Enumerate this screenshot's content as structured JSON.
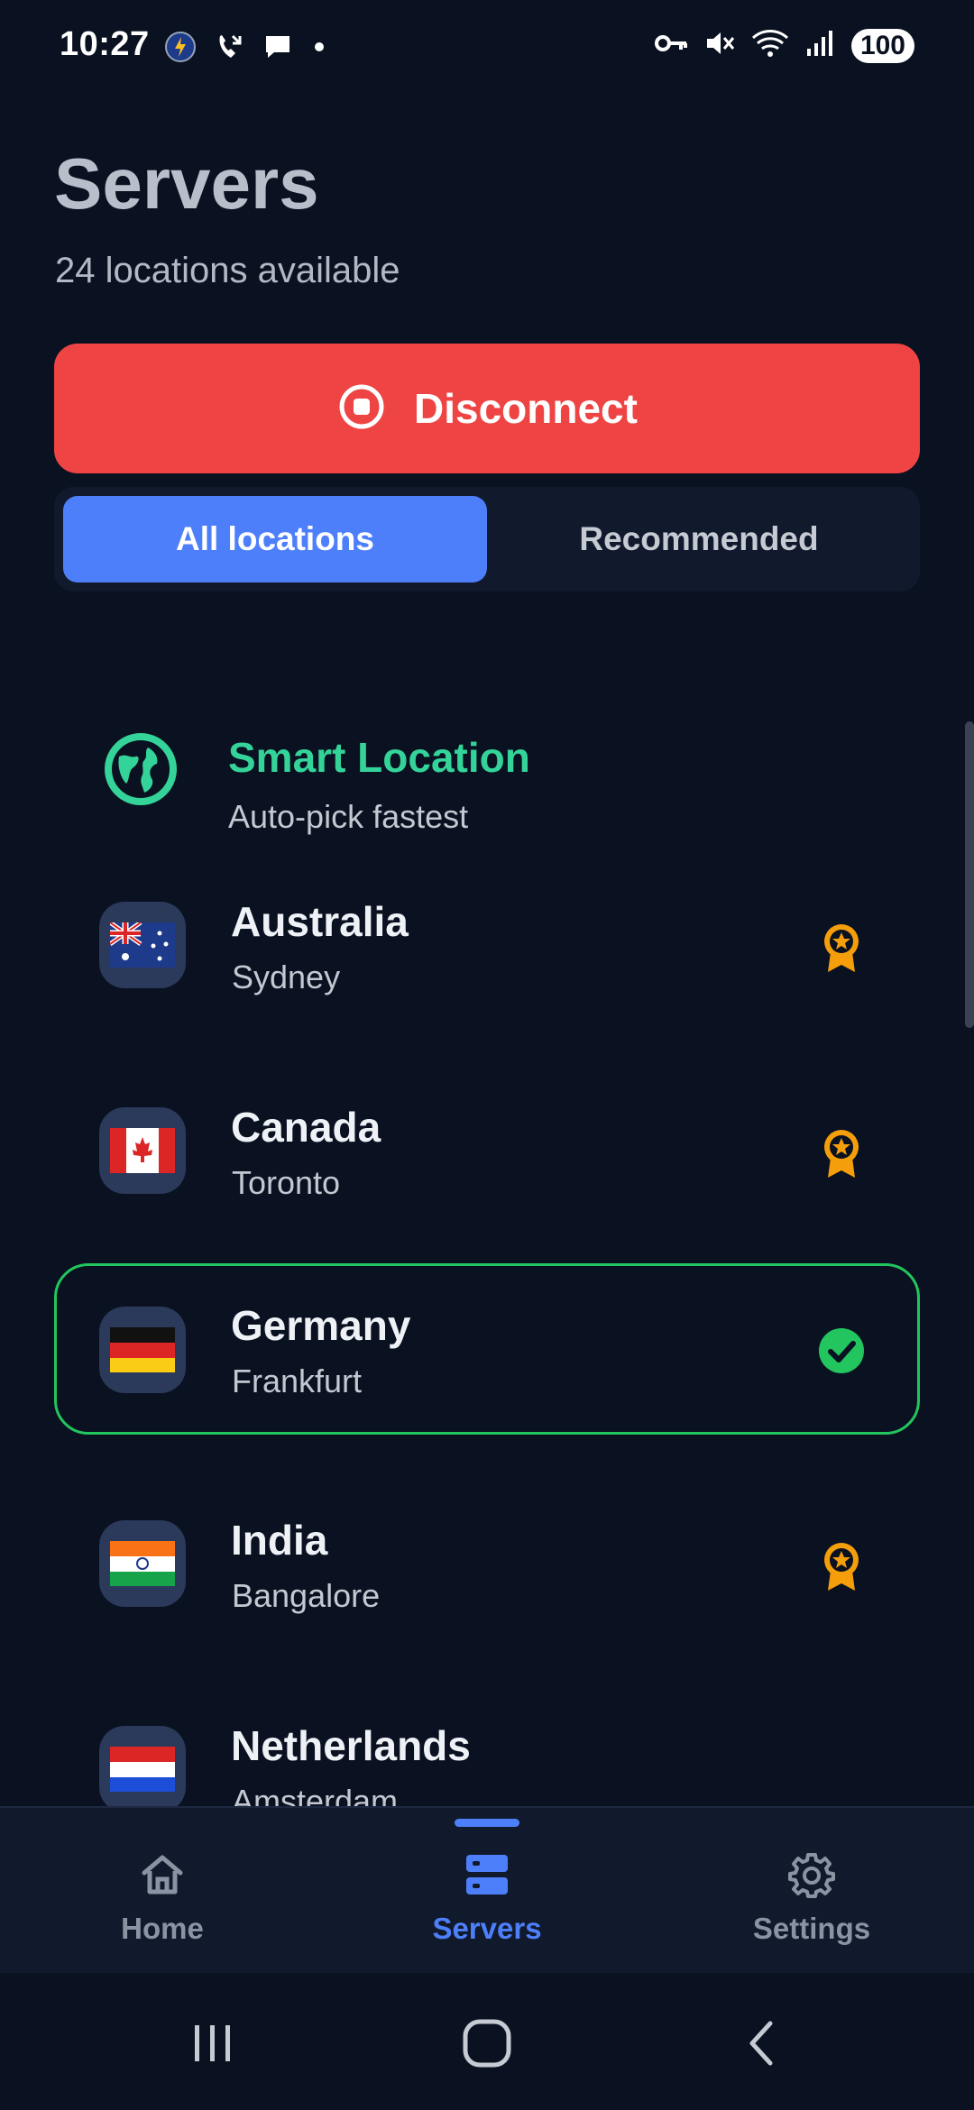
{
  "status_bar": {
    "time": "10:27",
    "battery": "100"
  },
  "header": {
    "title": "Servers",
    "subtitle": "24 locations available"
  },
  "disconnect": {
    "label": "Disconnect"
  },
  "tabs": [
    {
      "label": "All locations",
      "active": true
    },
    {
      "label": "Recommended",
      "active": false
    }
  ],
  "servers": [
    {
      "title": "Smart Location",
      "subtitle": "Auto-pick fastest",
      "icon": "globe-icon"
    },
    {
      "title": "Australia",
      "subtitle": "Sydney",
      "flag": "au",
      "badge": "recommended-badge-icon"
    },
    {
      "title": "Canada",
      "subtitle": "Toronto",
      "flag": "ca",
      "badge": "recommended-badge-icon"
    },
    {
      "title": "Germany",
      "subtitle": "Frankfurt",
      "flag": "de",
      "badge": "check-circle-icon",
      "selected": true
    },
    {
      "title": "India",
      "subtitle": "Bangalore",
      "flag": "in",
      "badge": "recommended-badge-icon"
    },
    {
      "title": "Netherlands",
      "subtitle": "Amsterdam",
      "flag": "nl"
    }
  ],
  "bottom_nav": [
    {
      "label": "Home",
      "icon": "home-icon",
      "active": false
    },
    {
      "label": "Servers",
      "icon": "servers-icon",
      "active": true
    },
    {
      "label": "Settings",
      "icon": "gear-icon",
      "active": false
    }
  ],
  "colors": {
    "background": "#0a1120",
    "accent": "#4e7ffb",
    "danger": "#ef4444",
    "success": "#22c55e",
    "smart": "#34d399",
    "badge": "#f59e0b"
  }
}
